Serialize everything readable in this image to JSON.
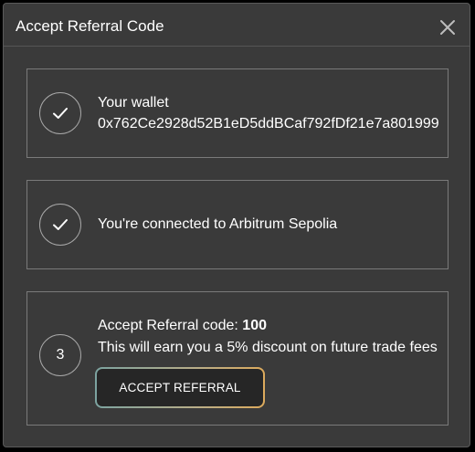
{
  "dialog": {
    "title": "Accept Referral Code",
    "close_icon": "close-icon"
  },
  "steps": [
    {
      "status": "done",
      "icon": "checkmark-icon",
      "label": "Your wallet",
      "value": "0x762Ce2928d52B1eD5ddBCaf792fDf21e7a801999"
    },
    {
      "status": "done",
      "icon": "checkmark-icon",
      "label": "You're connected to Arbitrum Sepolia"
    },
    {
      "status": "current",
      "number": "3",
      "label_prefix": "Accept Referral code: ",
      "code": "100",
      "description": "This will earn you a 5% discount on future trade fees",
      "button_label": "ACCEPT REFERRAL"
    }
  ],
  "colors": {
    "dialog_bg": "#3a3a3a",
    "text": "#ffffff",
    "button_bg": "#262626",
    "button_gradient_start": "#7ca3a0",
    "button_gradient_end": "#dcaa5c"
  }
}
